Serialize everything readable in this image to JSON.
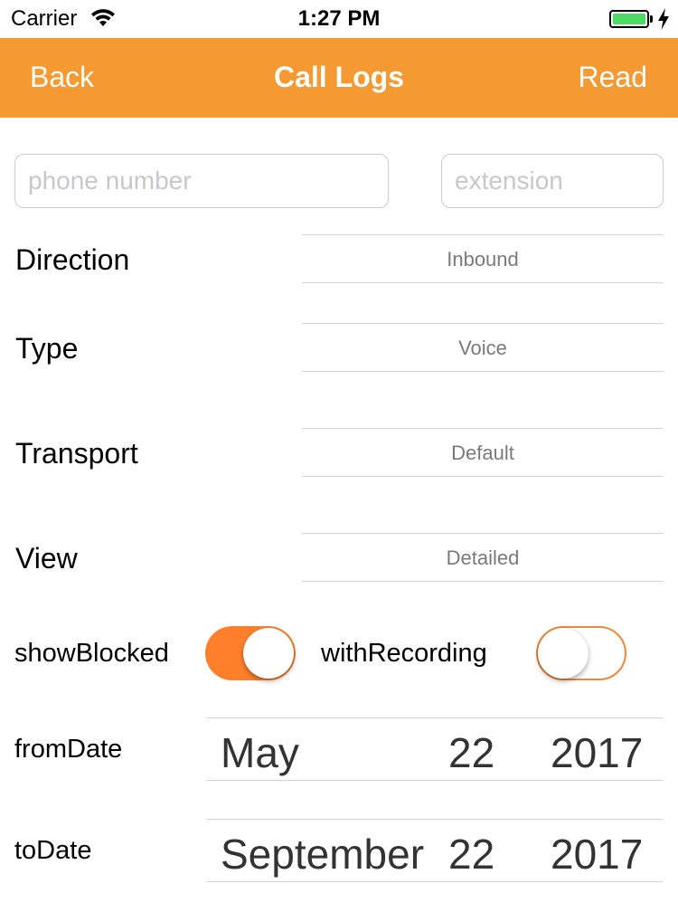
{
  "status_bar": {
    "carrier": "Carrier",
    "time": "1:27 PM"
  },
  "nav": {
    "back_label": "Back",
    "title": "Call Logs",
    "action_label": "Read"
  },
  "inputs": {
    "phone_placeholder": "phone number",
    "extension_placeholder": "extension"
  },
  "rows": [
    {
      "label": "Direction",
      "value": "Inbound"
    },
    {
      "label": "Type",
      "value": "Voice"
    },
    {
      "label": "Transport",
      "value": "Default"
    },
    {
      "label": "View",
      "value": "Detailed"
    }
  ],
  "toggles": {
    "show_blocked": {
      "label": "showBlocked",
      "on": true
    },
    "with_recording": {
      "label": "withRecording",
      "on": false
    }
  },
  "dates": {
    "from": {
      "label": "fromDate",
      "month": "May",
      "day": "22",
      "year": "2017"
    },
    "to": {
      "label": "toDate",
      "month": "September",
      "day": "22",
      "year": "2017"
    }
  },
  "colors": {
    "accent": "#f59a33",
    "toggle_on": "#ff7f2a",
    "battery": "#4cd964"
  },
  "icons": {
    "wifi": "wifi-icon",
    "battery": "battery-icon",
    "charging": "charging-bolt-icon"
  }
}
